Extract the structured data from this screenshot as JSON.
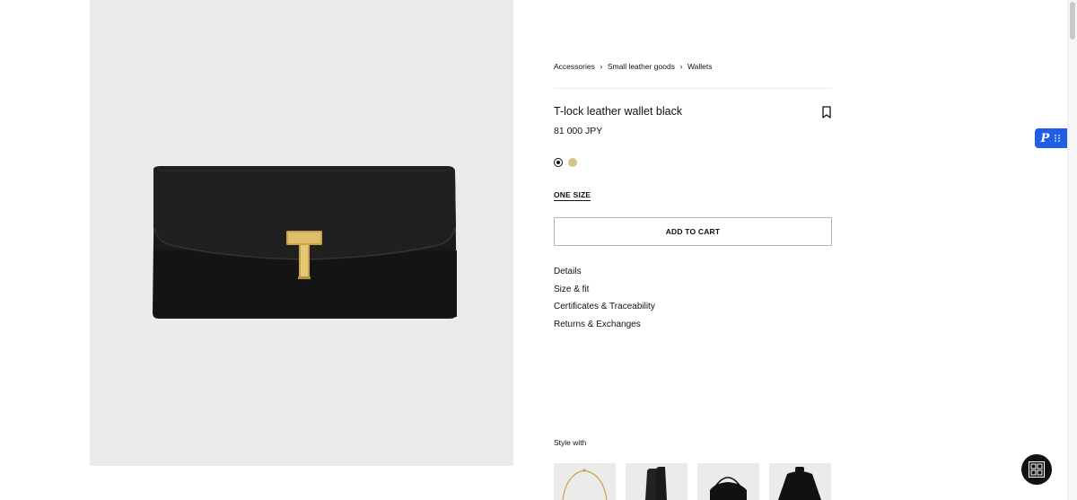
{
  "breadcrumb": {
    "items": [
      "Accessories",
      "Small leather goods",
      "Wallets"
    ],
    "separator": "›"
  },
  "product": {
    "title": "T-lock leather wallet black",
    "price": "81 000 JPY",
    "swatches": [
      {
        "name": "black",
        "color": "#111111",
        "selected": true
      },
      {
        "name": "tan",
        "color": "#d8bf8e",
        "selected": false
      }
    ],
    "size": "ONE SIZE",
    "add_to_cart": "ADD TO CART",
    "image_icon": "black-leather-wallet-with-gold-t-lock"
  },
  "accordion": [
    "Details",
    "Size & fit",
    "Certificates & Traceability",
    "Returns & Exchanges"
  ],
  "style_with": {
    "label": "Style with",
    "items": [
      {
        "icon": "gold-necklace"
      },
      {
        "icon": "black-boots"
      },
      {
        "icon": "black-handbag"
      },
      {
        "icon": "black-sweater"
      }
    ]
  },
  "icons": {
    "bookmark": "bookmark-icon",
    "extension": "pocket-extension-icon",
    "chat": "chat-icon"
  },
  "colors": {
    "image_bg": "#ebebeb",
    "accent_ext": "#1f5fe8",
    "text": "#111111"
  }
}
